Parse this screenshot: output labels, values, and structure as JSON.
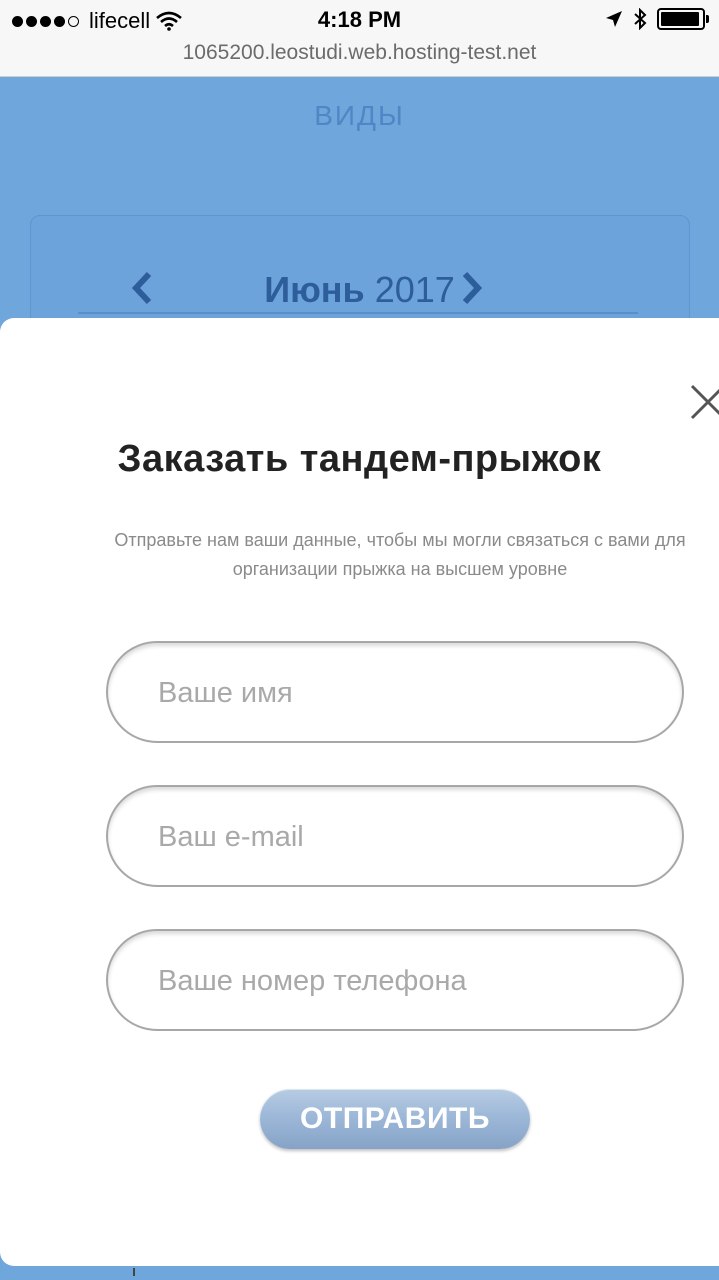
{
  "status_bar": {
    "carrier": "lifecell",
    "time": "4:18 PM",
    "signal_bars": 4,
    "signal_total": 5
  },
  "url_bar": {
    "url": "1065200.leostudi.web.hosting-test.net"
  },
  "background": {
    "section_title": "ВИДЫ",
    "calendar": {
      "month": "Июнь",
      "year": "2017"
    }
  },
  "modal": {
    "title": "Заказать тандем-прыжок",
    "description_line1": "Отправьте нам ваши данные, чтобы мы могли связаться с вами для",
    "description_line2": "организации прыжка на высшем уровне",
    "fields": [
      {
        "placeholder": "Ваше имя",
        "value": ""
      },
      {
        "placeholder": "Ваш e-mail",
        "value": ""
      },
      {
        "placeholder": "Ваше номер телефона",
        "value": ""
      }
    ],
    "submit_label": "ОТПРАВИТЬ"
  },
  "colors": {
    "page_background": "#6fa6dc",
    "calendar_text": "#2d5d9a",
    "button": "#9db8d8"
  },
  "icons": [
    "wifi-icon",
    "location-arrow-icon",
    "bluetooth-icon",
    "battery-icon",
    "chevron-left-icon",
    "chevron-right-icon",
    "close-icon"
  ]
}
